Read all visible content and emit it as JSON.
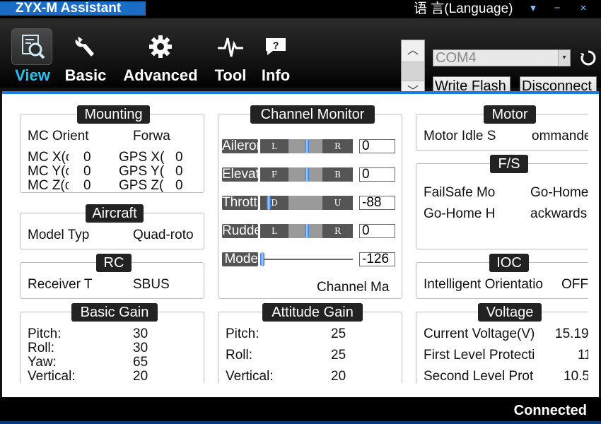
{
  "app": {
    "title": "ZYX-M Assistant",
    "language": "语 言(Language)"
  },
  "window": {
    "dropdown": "▾",
    "minimize": "−",
    "close": "×"
  },
  "toolbar": {
    "tabs": [
      {
        "label": "View",
        "icon": "view-search-icon",
        "active": true
      },
      {
        "label": "Basic",
        "icon": "wrench-icon"
      },
      {
        "label": "Advanced",
        "icon": "gear-icon"
      },
      {
        "label": "Tool",
        "icon": "pulse-icon"
      },
      {
        "label": "Info",
        "icon": "info-chat-icon"
      }
    ],
    "scroll_up": "︿",
    "scroll_down": "﹀",
    "com_port": "COM4",
    "com_arrow": "▾",
    "write_flash": "Write Flash",
    "disconnect": "Disconnect",
    "accent": "#29c0f2"
  },
  "mounting": {
    "title": "Mounting",
    "mc_orient_label": "MC Orient",
    "mc_orient_value": "Forwa",
    "mc_x_label": "MC X(c",
    "mc_x_value": "0",
    "mc_y_label": "MC Y(c",
    "mc_y_value": "0",
    "mc_z_label": "MC Z(c",
    "mc_z_value": "0",
    "gps_x_label": "GPS X(",
    "gps_x_value": "0",
    "gps_y_label": "GPS Y(",
    "gps_y_value": "0",
    "gps_z_label": "GPS Z(",
    "gps_z_value": "0"
  },
  "aircraft": {
    "title": "Aircraft",
    "model_label": "Model Typ",
    "model_value": "Quad-roto"
  },
  "rc": {
    "title": "RC",
    "receiver_label": "Receiver T",
    "receiver_value": "SBUS"
  },
  "basic_gain": {
    "title": "Basic Gain",
    "rows": [
      {
        "label": "Pitch:",
        "value": "30"
      },
      {
        "label": "Roll:",
        "value": "30"
      },
      {
        "label": "Yaw:",
        "value": "65"
      },
      {
        "label": "Vertical:",
        "value": "20"
      }
    ]
  },
  "channel_monitor": {
    "title": "Channel Monitor",
    "channels": [
      {
        "label": "Aileron",
        "left": "L",
        "right": "R",
        "value": "0",
        "position": 0.5
      },
      {
        "label": "Elevator",
        "left": "F",
        "right": "B",
        "value": "0",
        "position": 0.5
      },
      {
        "label": "Throttle",
        "left": "D",
        "right": "U",
        "value": "-88",
        "position": 0.07
      },
      {
        "label": "Rudder",
        "left": "L",
        "right": "R",
        "value": "0",
        "position": 0.5
      },
      {
        "label": "Mode",
        "left": "",
        "right": "",
        "value": "-126",
        "position": 0.0
      }
    ],
    "footer": "Channel Ma"
  },
  "attitude_gain": {
    "title": "Attitude Gain",
    "rows": [
      {
        "label": "Pitch:",
        "value": "25"
      },
      {
        "label": "Roll:",
        "value": "25"
      },
      {
        "label": "Vertical:",
        "value": "20"
      }
    ]
  },
  "motor": {
    "title": "Motor",
    "idle_label": "Motor Idle S",
    "idle_value": "ommanded"
  },
  "failsafe": {
    "title": "F/S",
    "mode_label": "FailSafe Mo",
    "mode_value": "Go-Home",
    "gohome_label": "Go-Home H",
    "gohome_value": "ackwards"
  },
  "ioc": {
    "title": "IOC",
    "label": "Intelligent Orientatio",
    "value": "OFF"
  },
  "voltage": {
    "title": "Voltage",
    "current_label": "Current Voltage(V)",
    "current_value": "15.19",
    "first_label": "First Level Protecti",
    "first_value": "11",
    "second_label": "Second Level Prot",
    "second_value": "10.5"
  },
  "status": {
    "text": "Connected"
  }
}
